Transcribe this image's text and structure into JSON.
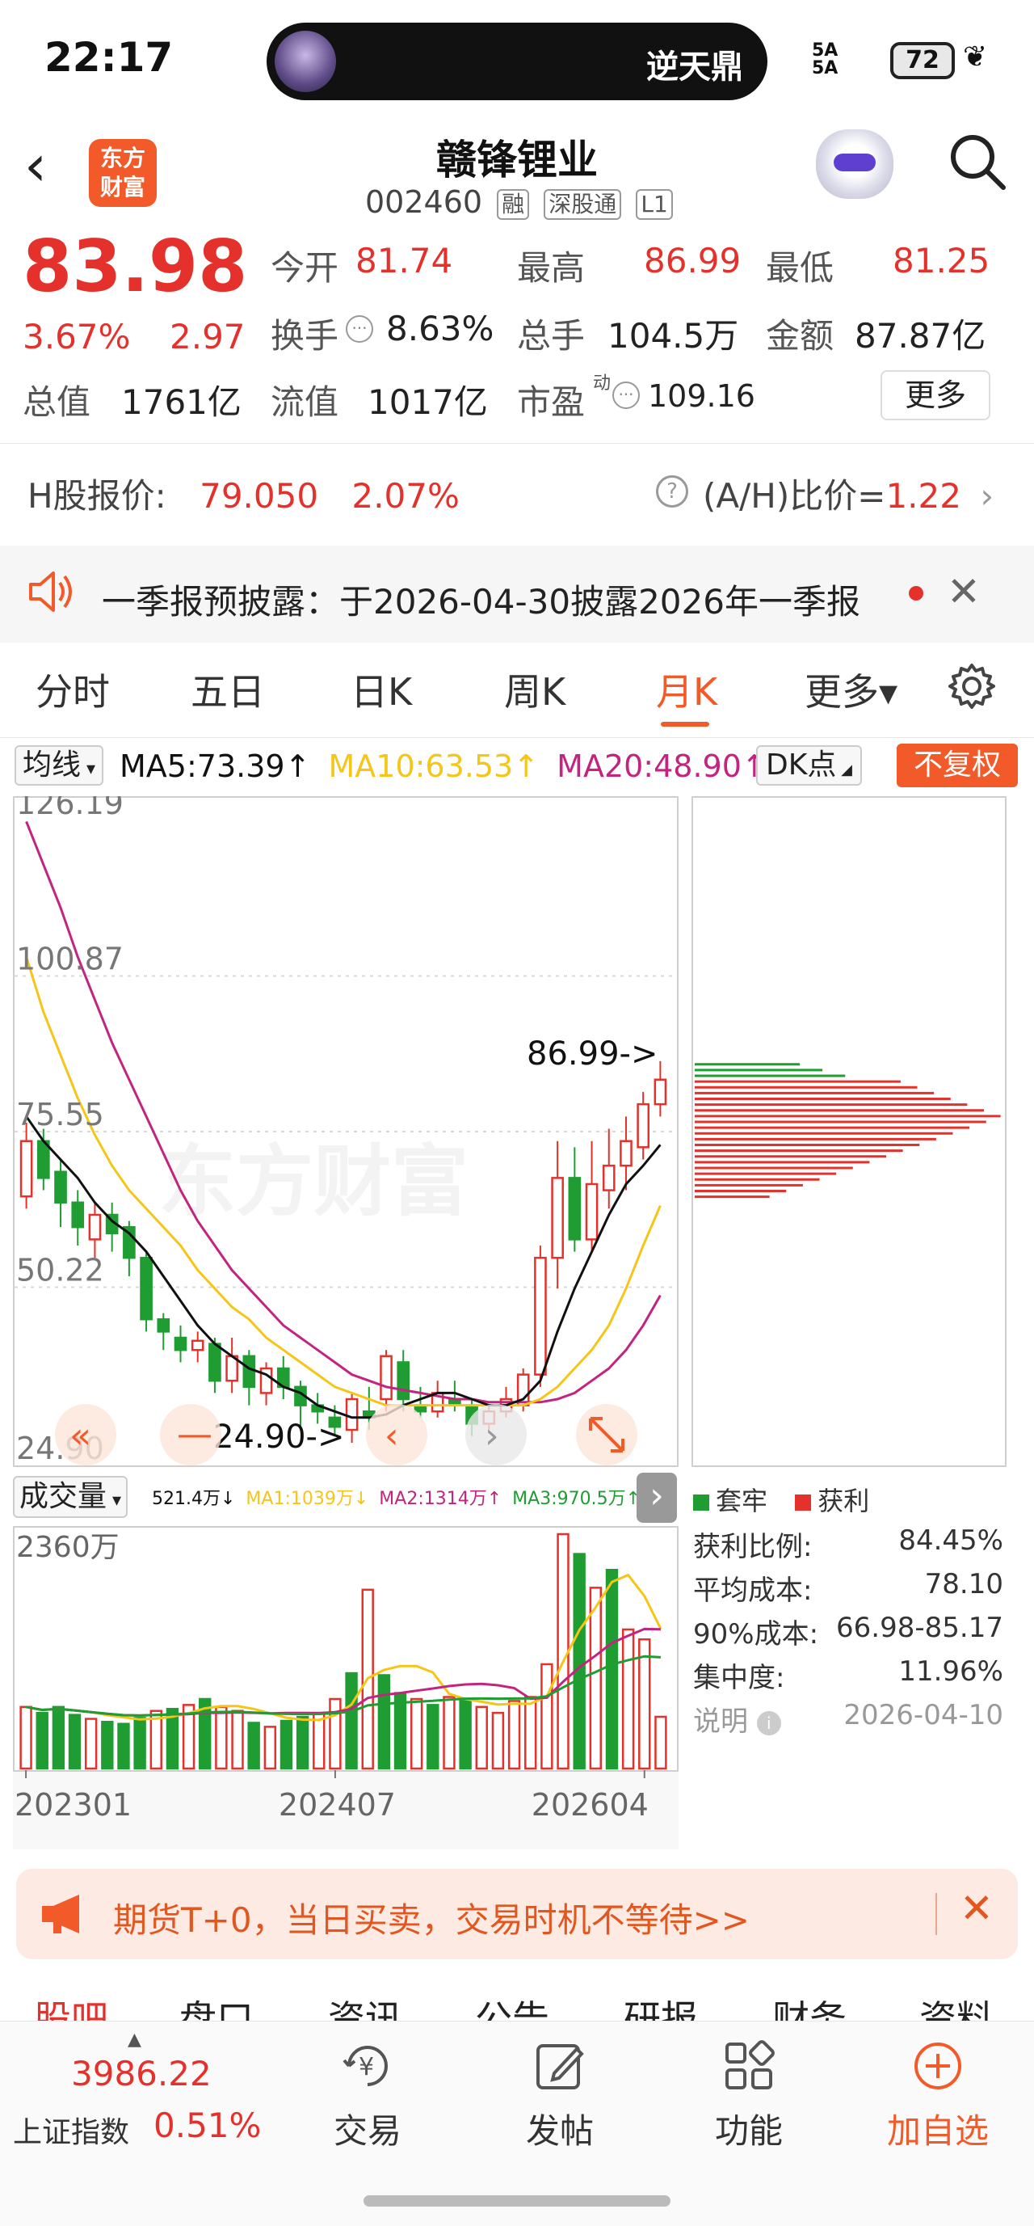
{
  "status_bar": {
    "time": "22:17",
    "island_text": "逆天鼎",
    "signal_text": "5A\n5A",
    "battery": "72"
  },
  "header": {
    "logo_text": "东方\n财富",
    "stock_name": "赣锋锂业",
    "stock_code": "002460",
    "tags": [
      "融",
      "深股通",
      "L1"
    ]
  },
  "quote": {
    "price": "83.98",
    "change_pct": "3.67%",
    "change_amt": "2.97",
    "open_label": "今开",
    "open": "81.74",
    "high_label": "最高",
    "high": "86.99",
    "low_label": "最低",
    "low": "81.25",
    "turnover_label": "换手",
    "turnover": "8.63%",
    "volume_label": "总手",
    "volume": "104.5万",
    "amount_label": "金额",
    "amount": "87.87亿",
    "mktcap_label": "总值",
    "mktcap": "1761亿",
    "float_label": "流值",
    "float_cap": "1017亿",
    "pe_label": "市盈",
    "pe_sup": "动",
    "pe": "109.16",
    "more": "更多"
  },
  "h_share": {
    "label": "H股报价:",
    "price": "79.050",
    "pct": "2.07%",
    "ratio_label": "(A/H)比价=",
    "ratio": "1.22"
  },
  "notice": {
    "text": "一季报预披露：于2026-04-30披露2026年一季报"
  },
  "tabs": [
    "分时",
    "五日",
    "日K",
    "周K",
    "月K",
    "更多▾"
  ],
  "ma": {
    "selector": "均线",
    "ma5": "MA5:73.39↑",
    "ma10": "MA10:63.53↑",
    "ma20": "MA20:48.90↑",
    "dk": "DK点",
    "fq": "不复权"
  },
  "colors": {
    "up": "#e4312b",
    "down": "#1f9d33",
    "accent": "#f25a29",
    "ma5": "#111111",
    "ma10": "#f5c518",
    "ma20": "#c2247f"
  },
  "chart_data": [
    {
      "type": "candlestick",
      "y_ticks": [
        "126.19",
        "100.87",
        "75.55",
        "50.22",
        "24.90"
      ],
      "ylim": [
        24.9,
        126.19
      ],
      "high_marker": "86.99->",
      "low_marker": "24.90->",
      "watermark": "东方财富",
      "candles": [
        {
          "o": 65.0,
          "c": 74.0,
          "h": 77.0,
          "l": 63.0
        },
        {
          "o": 74.0,
          "c": 68.0,
          "h": 76.0,
          "l": 66.0
        },
        {
          "o": 69.0,
          "c": 64.0,
          "h": 71.0,
          "l": 60.0
        },
        {
          "o": 64.0,
          "c": 60.0,
          "h": 66.0,
          "l": 57.0
        },
        {
          "o": 58.0,
          "c": 62.0,
          "h": 64.0,
          "l": 55.0
        },
        {
          "o": 62.0,
          "c": 59.0,
          "h": 64.0,
          "l": 56.0
        },
        {
          "o": 60.0,
          "c": 55.0,
          "h": 61.0,
          "l": 52.0
        },
        {
          "o": 55.0,
          "c": 45.0,
          "h": 56.0,
          "l": 43.0
        },
        {
          "o": 45.0,
          "c": 43.0,
          "h": 46.0,
          "l": 40.0
        },
        {
          "o": 42.0,
          "c": 40.0,
          "h": 44.0,
          "l": 38.0
        },
        {
          "o": 40.0,
          "c": 41.5,
          "h": 43.0,
          "l": 38.0
        },
        {
          "o": 41.0,
          "c": 35.0,
          "h": 42.0,
          "l": 33.0
        },
        {
          "o": 35.0,
          "c": 39.0,
          "h": 42.0,
          "l": 33.0
        },
        {
          "o": 39.0,
          "c": 34.0,
          "h": 40.0,
          "l": 31.0
        },
        {
          "o": 33.0,
          "c": 37.0,
          "h": 38.0,
          "l": 31.0
        },
        {
          "o": 37.0,
          "c": 34.0,
          "h": 39.0,
          "l": 32.0
        },
        {
          "o": 34.0,
          "c": 31.0,
          "h": 35.0,
          "l": 27.0
        },
        {
          "o": 31.0,
          "c": 30.0,
          "h": 33.0,
          "l": 28.0
        },
        {
          "o": 29.0,
          "c": 27.5,
          "h": 31.0,
          "l": 26.0
        },
        {
          "o": 27.0,
          "c": 32.0,
          "h": 33.0,
          "l": 24.9
        },
        {
          "o": 30.0,
          "c": 29.0,
          "h": 34.0,
          "l": 27.0
        },
        {
          "o": 32.0,
          "c": 39.0,
          "h": 40.0,
          "l": 30.0
        },
        {
          "o": 38.0,
          "c": 32.0,
          "h": 40.0,
          "l": 30.0
        },
        {
          "o": 31.0,
          "c": 30.0,
          "h": 34.0,
          "l": 29.0
        },
        {
          "o": 30.0,
          "c": 33.0,
          "h": 35.0,
          "l": 29.0
        },
        {
          "o": 32.0,
          "c": 31.0,
          "h": 35.0,
          "l": 30.0
        },
        {
          "o": 31.0,
          "c": 28.0,
          "h": 32.0,
          "l": 26.0
        },
        {
          "o": 28.0,
          "c": 30.0,
          "h": 31.0,
          "l": 27.0
        },
        {
          "o": 30.0,
          "c": 32.0,
          "h": 34.0,
          "l": 29.0
        },
        {
          "o": 31.0,
          "c": 36.0,
          "h": 37.0,
          "l": 30.0
        },
        {
          "o": 36.0,
          "c": 55.0,
          "h": 57.0,
          "l": 34.0
        },
        {
          "o": 55.0,
          "c": 68.0,
          "h": 74.0,
          "l": 50.0
        },
        {
          "o": 68.0,
          "c": 58.0,
          "h": 73.0,
          "l": 56.0
        },
        {
          "o": 58.0,
          "c": 67.0,
          "h": 74.0,
          "l": 56.0
        },
        {
          "o": 66.0,
          "c": 70.0,
          "h": 76.0,
          "l": 63.0
        },
        {
          "o": 70.0,
          "c": 74.0,
          "h": 78.0,
          "l": 66.0
        },
        {
          "o": 73.0,
          "c": 80.0,
          "h": 82.0,
          "l": 71.0
        },
        {
          "o": 80.0,
          "c": 84.0,
          "h": 87.0,
          "l": 78.0
        }
      ],
      "ma5": [
        78,
        74,
        71,
        68,
        64,
        61,
        59,
        56,
        52,
        48,
        44,
        41,
        39,
        37,
        36,
        34,
        33,
        31,
        30,
        29,
        29,
        29.5,
        31,
        32,
        33,
        33,
        32,
        31,
        31,
        32,
        35,
        43,
        50,
        56,
        62,
        67,
        70,
        73.4
      ],
      "ma10": [
        104,
        95,
        88,
        81,
        75,
        70,
        66,
        63,
        60,
        57,
        53,
        50,
        47,
        45,
        42,
        40,
        38,
        36,
        34,
        33,
        32,
        31,
        31,
        31,
        31,
        31,
        31,
        31,
        31,
        31,
        32,
        34,
        37,
        40,
        44,
        50,
        57,
        63.5
      ],
      "ma20": [
        126,
        119,
        112,
        104,
        97,
        90,
        84,
        78,
        72,
        66,
        61,
        57,
        53,
        50,
        47,
        44,
        42,
        40,
        38,
        36,
        35,
        34,
        33.5,
        33,
        32.5,
        32,
        32,
        31.5,
        31.5,
        31.5,
        31.5,
        32,
        33,
        35,
        37,
        40,
        44,
        48.9
      ],
      "chip_legend": [
        "套牢",
        "获利"
      ]
    },
    {
      "type": "bar",
      "title": "成交量",
      "current": "521.4万↓",
      "ma1": "MA1:1039万↓",
      "ma2": "MA2:1314万↑",
      "ma3": "MA3:970.5万↑",
      "y_tick": "2360万",
      "ylim": [
        0,
        2360
      ],
      "x_ticks": [
        "202301",
        "202407",
        "202604"
      ],
      "values": [
        620,
        560,
        620,
        540,
        500,
        470,
        450,
        510,
        580,
        600,
        640,
        700,
        620,
        580,
        460,
        420,
        480,
        520,
        560,
        700,
        960,
        1800,
        940,
        760,
        700,
        640,
        720,
        680,
        620,
        560,
        680,
        720,
        1050,
        2360,
        2160,
        1820,
        2000,
        1400,
        1300,
        521
      ],
      "down": [
        0,
        1,
        1,
        1,
        0,
        1,
        1,
        1,
        0,
        1,
        0,
        1,
        0,
        0,
        1,
        0,
        1,
        1,
        0,
        0,
        1,
        0,
        1,
        1,
        0,
        1,
        0,
        1,
        0,
        0,
        0,
        0,
        0,
        0,
        1,
        0,
        1,
        0,
        0,
        0
      ]
    }
  ],
  "chip_stats": {
    "profit_ratio_label": "获利比例:",
    "profit_ratio": "84.45%",
    "avg_cost_label": "平均成本:",
    "avg_cost": "78.10",
    "cost90_label": "90%成本:",
    "cost90": "66.98-85.17",
    "concentration_label": "集中度:",
    "concentration": "11.96%",
    "note_label": "说明",
    "date": "2026-04-10"
  },
  "promo": {
    "text": "期货T+0，当日买卖，交易时机不等待>>"
  },
  "sub_tabs": [
    "股吧",
    "盘口",
    "资讯",
    "公告",
    "研报",
    "财务",
    "资料"
  ],
  "bottom_nav": {
    "index_value": "3986.22",
    "index_name": "上证指数",
    "index_pct": "0.51%",
    "items": [
      "交易",
      "发帖",
      "功能",
      "加自选"
    ]
  }
}
